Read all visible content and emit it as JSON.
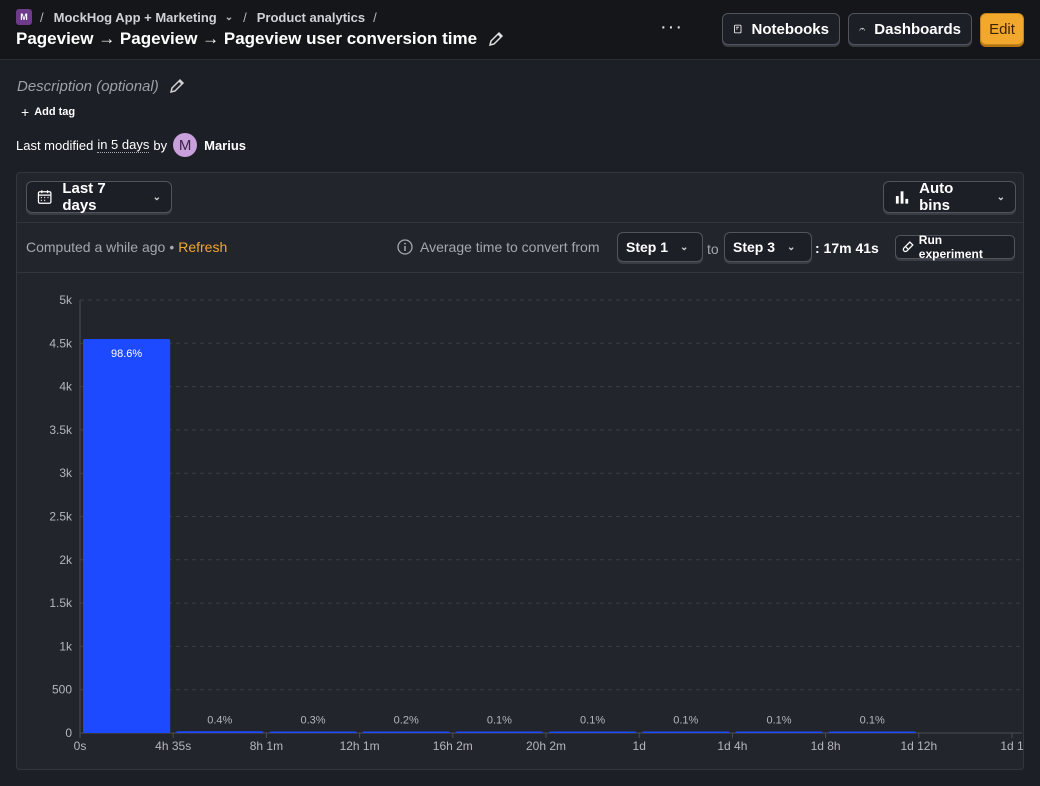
{
  "breadcrumbs": {
    "project_badge": "M",
    "project": "MockHog App + Marketing",
    "section": "Product analytics"
  },
  "insight": {
    "title": "Pageview → Pageview → Pageview user conversion time",
    "description_placeholder": "Description (optional)",
    "add_tag_label": "Add tag"
  },
  "toolbar": {
    "more_label": "···",
    "notebooks_label": "Notebooks",
    "dashboards_label": "Dashboards",
    "edit_label": "Edit"
  },
  "meta": {
    "modified_prefix": "Last modified",
    "modified_time": "in 5 days",
    "modified_by": "by",
    "avatar_letter": "M",
    "user_name": "Marius"
  },
  "filters": {
    "date_range": "Last 7 days",
    "bins": "Auto bins"
  },
  "status": {
    "computed": "Computed a while ago",
    "bullet": "•",
    "refresh": "Refresh",
    "avg_label": "Average time to convert from",
    "from_step": "Step 1",
    "to_label": "to",
    "to_step": "Step 3",
    "avg_value": ": 17m 41s",
    "run_experiment": "Run experiment"
  },
  "colors": {
    "bar": "#1d4aff",
    "accent": "#f1a82c"
  },
  "chart_data": {
    "type": "bar",
    "title": "",
    "xlabel": "",
    "ylabel": "",
    "x_ticks": [
      "0s",
      "4h 35s",
      "8h 1m",
      "12h 1m",
      "16h 2m",
      "20h 2m",
      "1d",
      "1d 4h",
      "1d 8h",
      "1d 12h",
      "1d 1"
    ],
    "y_ticks": [
      "0",
      "500",
      "1k",
      "1.5k",
      "2k",
      "2.5k",
      "3k",
      "3.5k",
      "4k",
      "4.5k",
      "5k"
    ],
    "ylim": [
      0,
      5000
    ],
    "values": [
      4550,
      20,
      14,
      9,
      5,
      5,
      5,
      5,
      5
    ],
    "labels": [
      "98.6%",
      "0.4%",
      "0.3%",
      "0.2%",
      "0.1%",
      "0.1%",
      "0.1%",
      "0.1%",
      "0.1%"
    ],
    "grid": true
  }
}
